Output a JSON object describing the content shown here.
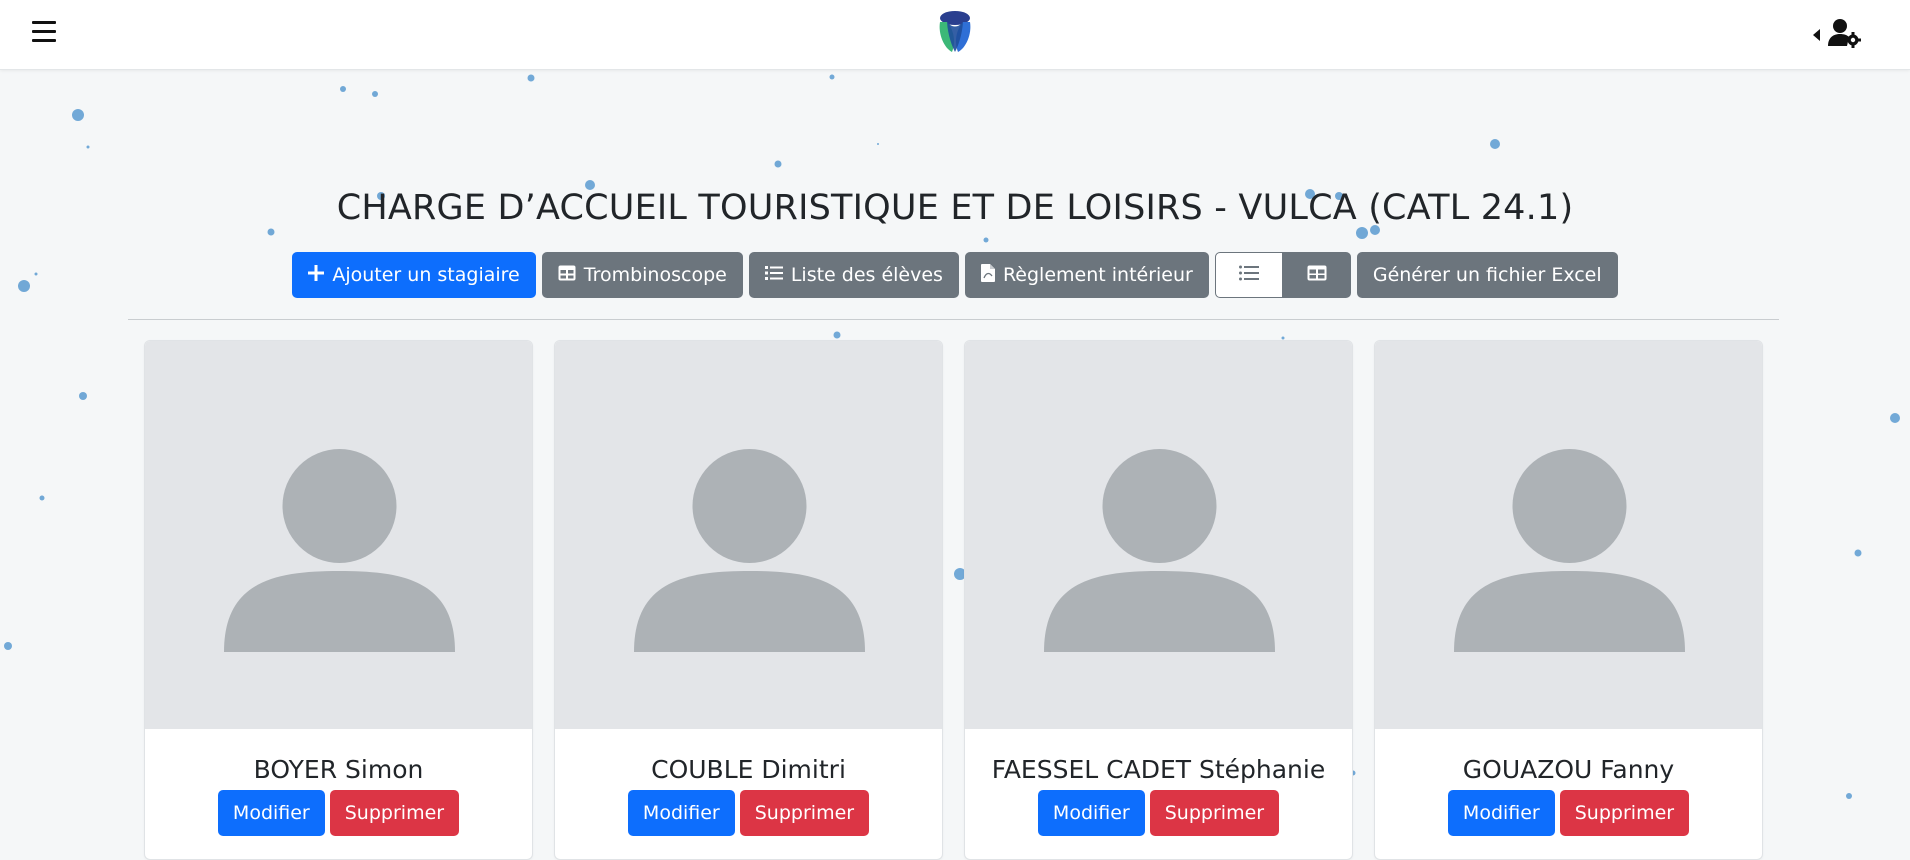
{
  "navbar": {
    "menu_icon": "hamburger-icon",
    "logo_icon": "app-logo",
    "user_icon": "user-gear-icon",
    "caret_icon": "caret-left-icon"
  },
  "page": {
    "title": "CHARGE D’ACCUEIL TOURISTIQUE ET DE LOISIRS - VULCA (CATL 24.1)"
  },
  "toolbar": {
    "add_label": "Ajouter un stagiaire",
    "trombinoscope_label": "Trombinoscope",
    "list_label": "Liste des élèves",
    "reglement_label": "Règlement intérieur",
    "excel_label": "Générer un fichier Excel",
    "view_list_icon": "list-icon",
    "view_grid_icon": "grid-icon"
  },
  "colors": {
    "primary": "#0d6efd",
    "secondary": "#6c757d",
    "danger": "#dc3545",
    "dots": "#5b9bd1"
  },
  "students": [
    {
      "name": "BOYER Simon",
      "edit_label": "Modifier",
      "delete_label": "Supprimer"
    },
    {
      "name": "COUBLE Dimitri",
      "edit_label": "Modifier",
      "delete_label": "Supprimer"
    },
    {
      "name": "FAESSEL CADET Stéphanie",
      "edit_label": "Modifier",
      "delete_label": "Supprimer"
    },
    {
      "name": "GOUAZOU Fanny",
      "edit_label": "Modifier",
      "delete_label": "Supprimer"
    }
  ]
}
